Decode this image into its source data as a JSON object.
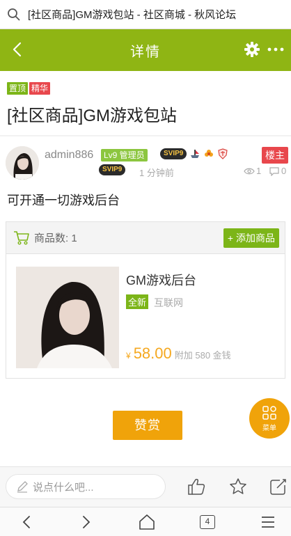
{
  "browser": {
    "tab_title": "[社区商品]GM游戏包站 - 社区商城 - 秋风论坛",
    "tabs_count": "4"
  },
  "header": {
    "title": "详情"
  },
  "post": {
    "tags": [
      "置顶",
      "精华"
    ],
    "title": "[社区商品]GM游戏包站",
    "author": "admin886",
    "level_badge": "Lv9 管理员",
    "svip_label": "SVIP9",
    "host_label": "楼主",
    "time": "1 分钟前",
    "views": "1",
    "comments": "0",
    "body": "可开通一切游戏后台"
  },
  "goods": {
    "count_label": "商品数: 1",
    "add_button": "+ 添加商品",
    "item": {
      "name": "GM游戏后台",
      "condition_badge": "全新",
      "source": "互联网",
      "currency": "¥",
      "price": "58.00",
      "extra": "附加 580 金钱"
    }
  },
  "actions": {
    "reward_button": "赞赏",
    "menu_label": "菜单",
    "comment_placeholder": "说点什么吧..."
  },
  "colors": {
    "brand_green": "#8fb514",
    "accent_orange": "#f0a30a",
    "hot_red": "#e8474c"
  }
}
